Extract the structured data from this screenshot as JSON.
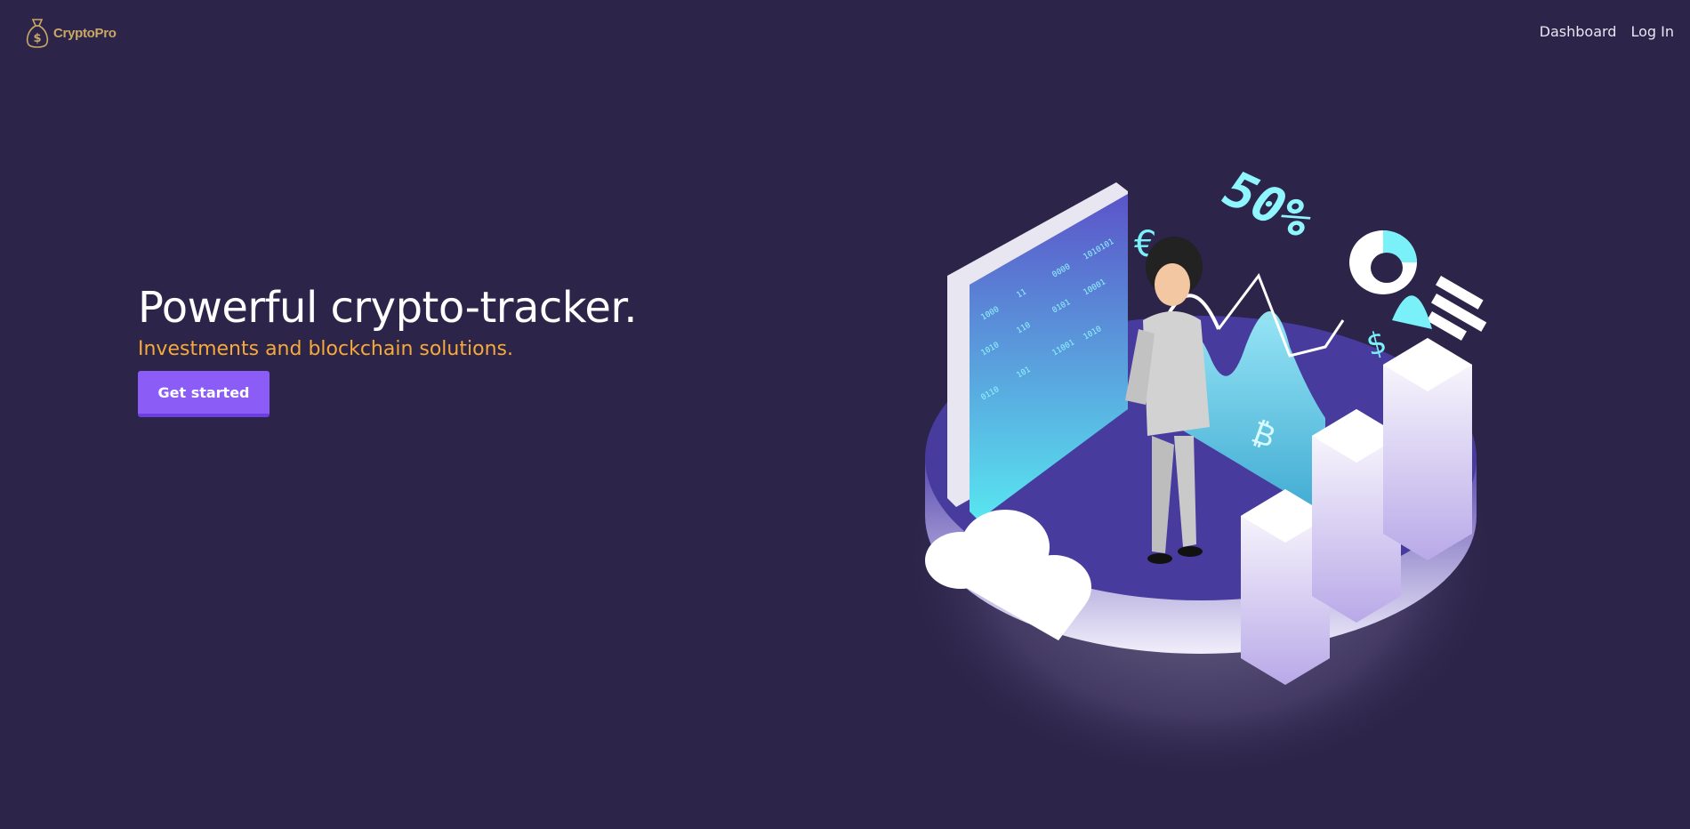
{
  "brand": {
    "name": "CryptoPro",
    "logo_icon": "money-bag-dollar-icon"
  },
  "nav": {
    "items": [
      {
        "label": "Dashboard"
      },
      {
        "label": "Log In"
      }
    ]
  },
  "hero": {
    "title": "Powerful crypto-tracker.",
    "subtitle": "Investments and blockchain solutions.",
    "cta_label": "Get started"
  },
  "illustration": {
    "subject": "isometric crypto trading platform illustration",
    "percent_text": "50%",
    "binary_columns": [
      "1000",
      "11",
      "0000",
      "1010101",
      "1010",
      "110",
      "0101",
      "10001",
      "0110",
      "101",
      "11001",
      "1010"
    ],
    "colors": {
      "accent": "#8b5cf6",
      "subtitle": "#f7a93a",
      "background": "#2c2449",
      "cyan": "#6ee9f2",
      "platform": "#4a3d9c"
    }
  }
}
